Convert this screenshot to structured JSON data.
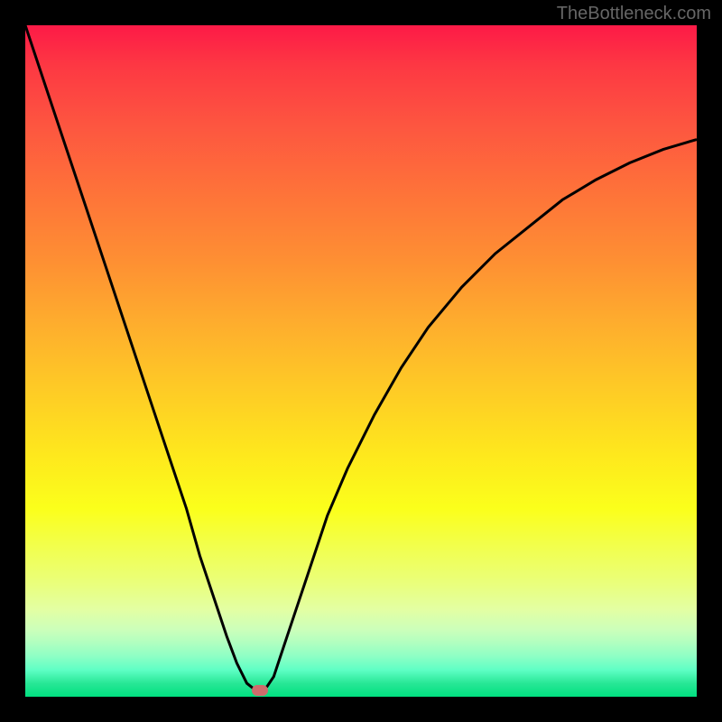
{
  "watermark": "TheBottleneck.com",
  "chart_data": {
    "type": "line",
    "title": "",
    "xlabel": "",
    "ylabel": "",
    "xlim": [
      0,
      100
    ],
    "ylim": [
      0,
      100
    ],
    "series": [
      {
        "name": "bottleneck-curve",
        "x": [
          0,
          3,
          6,
          9,
          12,
          15,
          18,
          21,
          24,
          26,
          28,
          30,
          31.5,
          33,
          34,
          35,
          36,
          37,
          38,
          40,
          42,
          45,
          48,
          52,
          56,
          60,
          65,
          70,
          75,
          80,
          85,
          90,
          95,
          100
        ],
        "values": [
          100,
          91,
          82,
          73,
          64,
          55,
          46,
          37,
          28,
          21,
          15,
          9,
          5,
          2,
          1.2,
          1,
          1.5,
          3,
          6,
          12,
          18,
          27,
          34,
          42,
          49,
          55,
          61,
          66,
          70,
          74,
          77,
          79.5,
          81.5,
          83
        ]
      }
    ],
    "marker": {
      "x": 35,
      "y": 1
    },
    "colors": {
      "curve": "#000000",
      "marker": "#ce6c6c",
      "gradient_top": "#fd1a47",
      "gradient_bottom": "#00e080"
    }
  }
}
